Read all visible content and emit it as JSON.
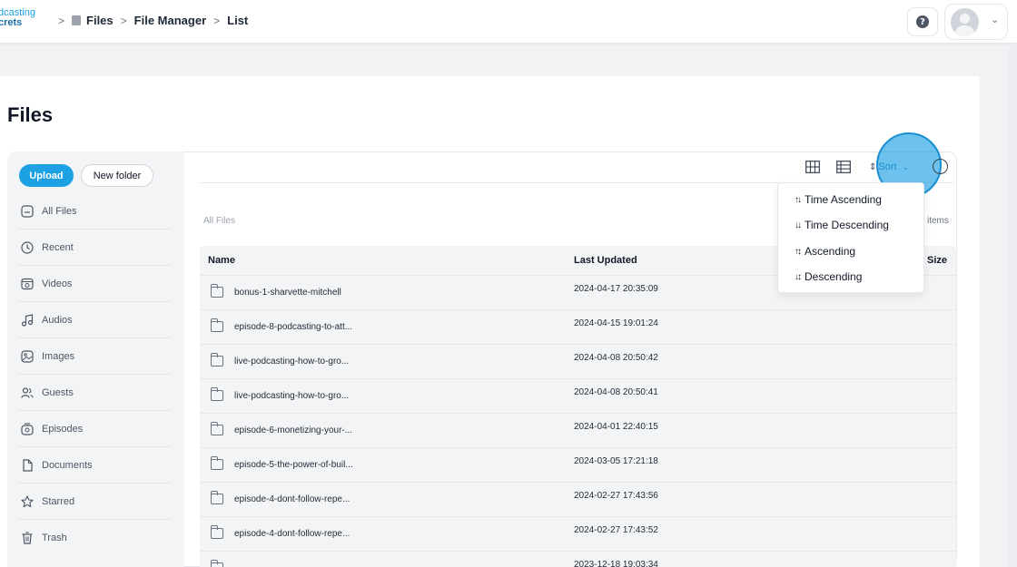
{
  "brand": {
    "line1": "dcasting",
    "line2": "crets"
  },
  "breadcrumb": {
    "items": [
      "Files",
      "File Manager",
      "List"
    ]
  },
  "header": {
    "help_icon": "question-circle-icon",
    "avatar_icon": "user-avatar-icon"
  },
  "page": {
    "title": "Files"
  },
  "actions": {
    "upload": "Upload",
    "new_folder": "New folder"
  },
  "sidebar": {
    "items": [
      {
        "label": "All Files",
        "icon": "all-files-icon"
      },
      {
        "label": "Recent",
        "icon": "clock-icon"
      },
      {
        "label": "Videos",
        "icon": "video-icon"
      },
      {
        "label": "Audios",
        "icon": "music-note-icon"
      },
      {
        "label": "Images",
        "icon": "image-icon"
      },
      {
        "label": "Guests",
        "icon": "guests-icon"
      },
      {
        "label": "Episodes",
        "icon": "episodes-icon"
      },
      {
        "label": "Documents",
        "icon": "document-icon"
      },
      {
        "label": "Starred",
        "icon": "star-icon"
      },
      {
        "label": "Trash",
        "icon": "trash-icon"
      }
    ]
  },
  "toolbar": {
    "sort_label": "Sort",
    "grid_icon": "grid-view-icon",
    "list_icon": "list-view-icon",
    "info_icon": "info-icon"
  },
  "location": {
    "label": "All Files",
    "items_suffix": "items"
  },
  "table": {
    "columns": [
      "Name",
      "Last Updated",
      "Size"
    ],
    "rows": [
      {
        "name": "bonus-1-sharvette-mitchell",
        "updated": "2024-04-17 20:35:09"
      },
      {
        "name": "episode-8-podcasting-to-att...",
        "updated": "2024-04-15 19:01:24"
      },
      {
        "name": "live-podcasting-how-to-gro...",
        "updated": "2024-04-08 20:50:42"
      },
      {
        "name": "live-podcasting-how-to-gro...",
        "updated": "2024-04-08 20:50:41"
      },
      {
        "name": "episode-6-monetizing-your-...",
        "updated": "2024-04-01 22:40:15"
      },
      {
        "name": "episode-5-the-power-of-buil...",
        "updated": "2024-03-05 17:21:18"
      },
      {
        "name": "episode-4-dont-follow-repe...",
        "updated": "2024-02-27 17:43:56"
      },
      {
        "name": "episode-4-dont-follow-repe...",
        "updated": "2024-02-27 17:43:52"
      },
      {
        "name": "",
        "updated": "2023-12-18 19:03:34"
      }
    ]
  },
  "sort_menu": {
    "options": [
      {
        "label": "Time Ascending",
        "symbol": "↑↓"
      },
      {
        "label": "Time Descending",
        "symbol": "↓↓"
      },
      {
        "label": "Ascending",
        "symbol": "↑↕"
      },
      {
        "label": "Descending",
        "symbol": "↓↕"
      }
    ]
  },
  "colors": {
    "accent": "#1da1e2",
    "focus_ring": "#1a8fd0"
  }
}
